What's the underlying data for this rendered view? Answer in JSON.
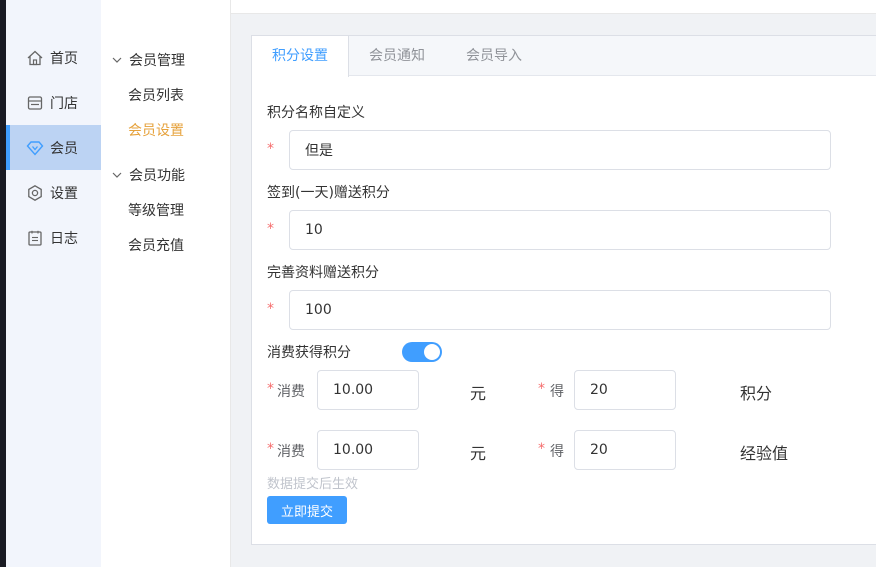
{
  "nav": {
    "items": [
      {
        "label": "首页",
        "icon": "home-icon"
      },
      {
        "label": "门店",
        "icon": "store-icon"
      },
      {
        "label": "会员",
        "icon": "diamond-icon"
      },
      {
        "label": "设置",
        "icon": "settings-icon"
      },
      {
        "label": "日志",
        "icon": "log-icon"
      }
    ],
    "active_index": 2
  },
  "submenu": {
    "groups": [
      {
        "label": "会员管理",
        "items": [
          "会员列表",
          "会员设置"
        ]
      },
      {
        "label": "会员功能",
        "items": [
          "等级管理",
          "会员充值"
        ]
      }
    ],
    "active_item": "会员设置"
  },
  "tabs": {
    "items": [
      "积分设置",
      "会员通知",
      "会员导入"
    ],
    "active_index": 0
  },
  "form": {
    "required_mark": "*",
    "points_name": {
      "label": "积分名称自定义",
      "value": "但是"
    },
    "checkin_points": {
      "label": "签到(一天)赠送积分",
      "value": "10"
    },
    "profile_points": {
      "label": "完善资料赠送积分",
      "value": "100"
    },
    "consume_points": {
      "label": "消费获得积分",
      "enabled": true,
      "rows": [
        {
          "spend_label": "消费",
          "spend_value": "10.00",
          "currency": "元",
          "get_label": "得",
          "get_value": "20",
          "reward_unit": "积分"
        },
        {
          "spend_label": "消费",
          "spend_value": "10.00",
          "currency": "元",
          "get_label": "得",
          "get_value": "20",
          "reward_unit": "经验值"
        }
      ]
    },
    "hint": "数据提交后生效",
    "submit_label": "立即提交"
  },
  "colors": {
    "primary": "#409eff",
    "active_submenu": "#e6a23c",
    "required": "#f56c6c",
    "sidebar_active": "#bcd3f3"
  }
}
